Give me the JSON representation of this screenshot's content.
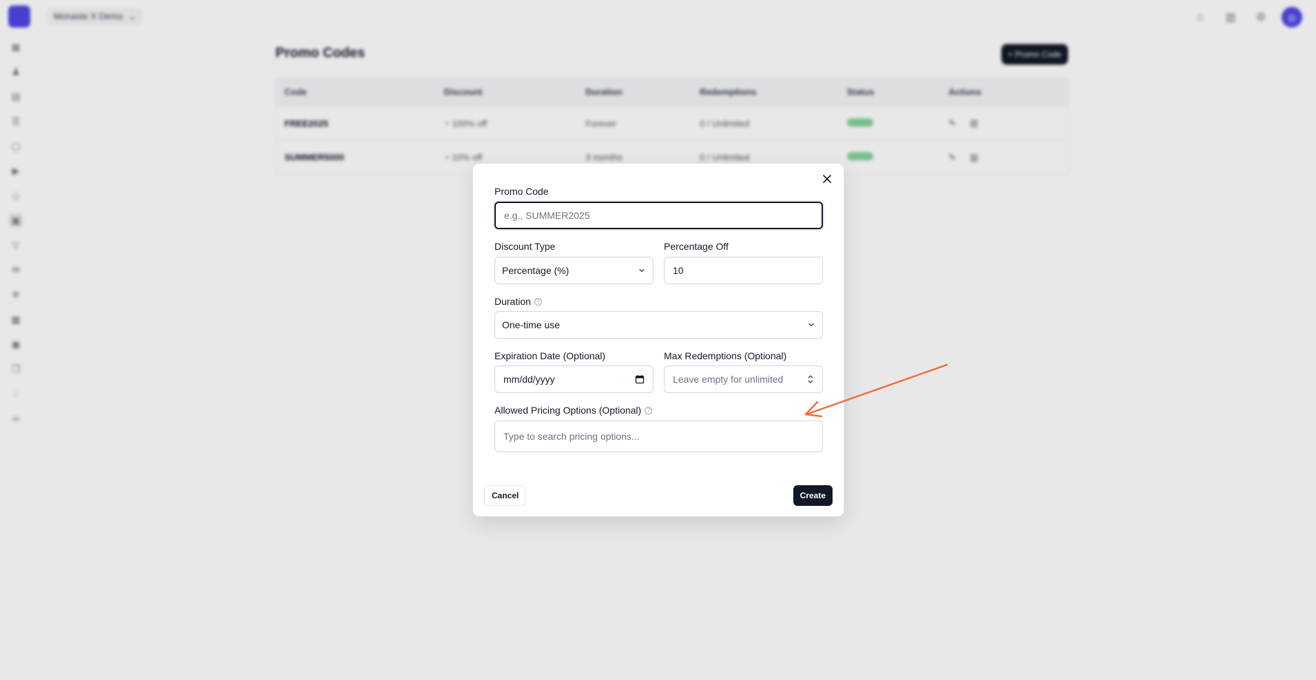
{
  "app": {
    "workspace_name": "Monaste X Demo",
    "workspace_chevron": "⌄"
  },
  "page": {
    "title": "Promo Codes",
    "new_button": "+ Promo Code"
  },
  "table": {
    "columns": [
      "Code",
      "Discount",
      "Duration",
      "Redemptions",
      "Status",
      "Actions"
    ],
    "rows": [
      {
        "code": "FREE2025",
        "discount": "100% off",
        "duration": "Forever",
        "redemptions": "0 / Unlimited"
      },
      {
        "code": "SUMMER5000",
        "discount": "10% off",
        "duration": "3 months",
        "redemptions": "0 / Unlimited"
      }
    ]
  },
  "dialog": {
    "promo_code_label": "Promo Code",
    "promo_code_placeholder": "e.g., SUMMER2025",
    "discount_type_label": "Discount Type",
    "discount_type_value": "Percentage (%)",
    "percentage_off_label": "Percentage Off",
    "percentage_off_value": "10",
    "duration_label": "Duration",
    "duration_value": "One-time use",
    "expiration_label": "Expiration Date (Optional)",
    "expiration_placeholder": "mm/dd/yyyy",
    "max_redemptions_label": "Max Redemptions (Optional)",
    "max_redemptions_placeholder": "Leave empty for unlimited",
    "pricing_label": "Allowed Pricing Options (Optional)",
    "pricing_placeholder": "Type to search pricing options...",
    "cancel_label": "Cancel",
    "create_label": "Create",
    "help_glyph": "?"
  },
  "colors": {
    "accent": "#4f46e5",
    "annotation_arrow": "#f26b3a",
    "primary_button": "#111827",
    "status_active": "#86d19a"
  }
}
